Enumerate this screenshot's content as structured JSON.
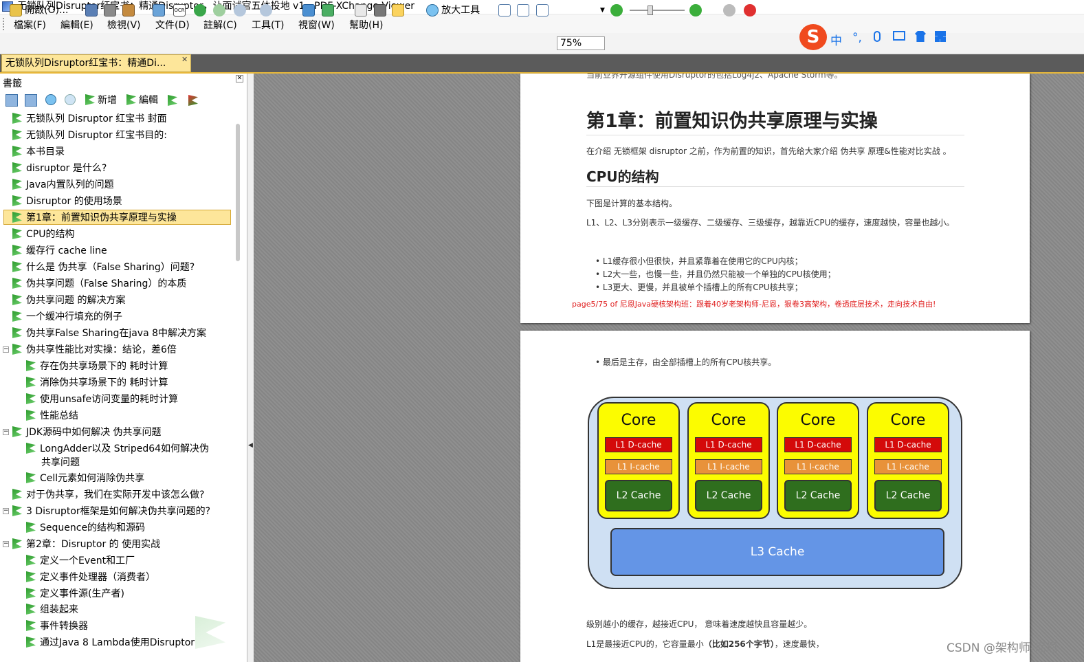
{
  "window": {
    "title": "无锁队列Disruptor红宝书：精通Disruptor，让面试官五体投地 v1 - PDF-XChange Viewer"
  },
  "menu": [
    "檔案(F)",
    "編輯(E)",
    "檢視(V)",
    "文件(D)",
    "註解(C)",
    "工具(T)",
    "視窗(W)",
    "幫助(H)"
  ],
  "toolbar": {
    "open_label": "開啟(O)...",
    "zoom_tool_label": "放大工具",
    "zoom_value": "75%"
  },
  "tab": {
    "label": "无锁队列Disruptor红宝书：精通Di..."
  },
  "bookmarks_panel": {
    "title": "書籤",
    "add_label": "新增",
    "edit_label": "編輯",
    "items": [
      "无锁队列 Disruptor 红宝书 封面",
      "无锁队列 Disruptor 红宝书目的:",
      "本书目录",
      "disruptor 是什么?",
      "Java内置队列的问题",
      "Disruptor 的使用场景",
      "第1章：前置知识伪共享原理与实操",
      "CPU的结构",
      "缓存行 cache line",
      "什么是 伪共享（False Sharing）问题?",
      "伪共享问题（False Sharing）的本质",
      "伪共享问题 的解决方案",
      "一个缓冲行填充的例子",
      "伪共享False Sharing在java 8中解决方案",
      "伪共享性能比对实操：结论，差6倍",
      "存在伪共享场景下的 耗时计算",
      "消除伪共享场景下的 耗时计算",
      "使用unsafe访问变量的耗时计算",
      "性能总结",
      "JDK源码中如何解决 伪共享问题",
      "LongAdder以及 Striped64如何解决伪",
      "共享问题",
      "Cell元素如何消除伪共享",
      "对于伪共享，我们在实际开发中该怎么做?",
      "3 Disruptor框架是如何解决伪共享问题的?",
      "Sequence的结构和源码",
      "第2章：Disruptor 的 使用实战",
      "定义一个Event和工厂",
      "定义事件处理器（消费者）",
      "定义事件源(生产者)",
      "组装起来",
      "事件转换器",
      "通过Java 8 Lambda使用Disruptor"
    ]
  },
  "page1": {
    "top_cut": "当前业界开源组件使用Disruptor的包括Log4j2、Apache Storm等。",
    "h1": "第1章：前置知识伪共享原理与实操",
    "intro": "在介绍 无锁框架 disruptor 之前，作为前置的知识，首先给大家介绍 伪共享 原理&性能对比实战 。",
    "h2": "CPU的结构",
    "p1": "下图是计算的基本结构。",
    "p2": "L1、L2、L3分别表示一级缓存、二级缓存、三级缓存，越靠近CPU的缓存，速度越快，容量也越小。",
    "bullets": [
      "L1缓存很小但很快，并且紧靠着在使用它的CPU内核；",
      "L2大一些，也慢一些，并且仍然只能被一个单独的CPU核使用；",
      "L3更大、更慢，并且被单个插槽上的所有CPU核共享；"
    ],
    "footer": "page5/75 of  尼恩Java硬核架构班：跟着40岁老架构师-尼恩，狠卷3高架构，卷透底层技术，走向技术自由!"
  },
  "page2": {
    "bullet": "最后是主存，由全部插槽上的所有CPU核共享。",
    "diagram": {
      "core_label": "Core",
      "l1d": "L1 D-cache",
      "l1i": "L1 I-cache",
      "l2": "L2 Cache",
      "l3": "L3 Cache"
    },
    "p1": "级别越小的缓存，越接近CPU， 意味着速度越快且容量越少。",
    "p2_a": "L1是最接近CPU的，它容量最小",
    "p2_b": "（比如256个字节）",
    "p2_c": "，速度最快，"
  },
  "ime": {
    "lang": "中",
    "punct": "°,"
  },
  "watermark": "CSDN @架构师-尼恩"
}
